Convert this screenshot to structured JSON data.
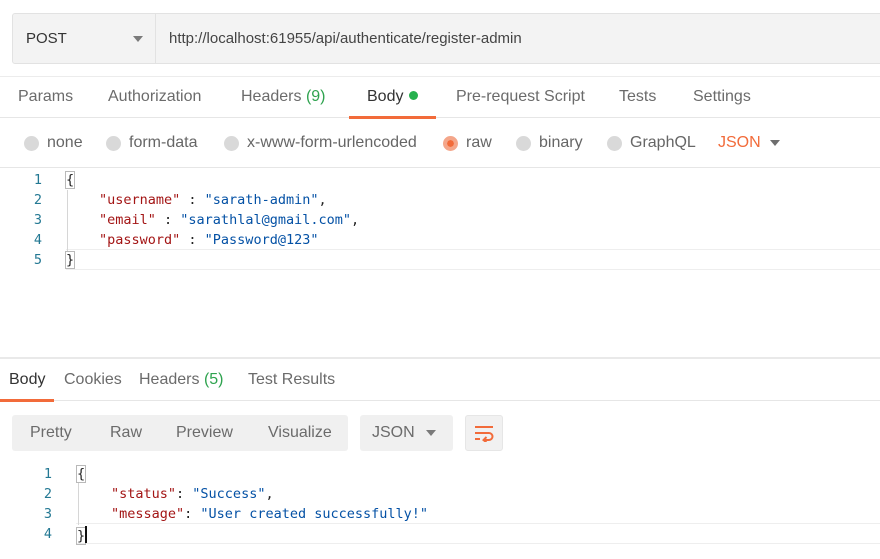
{
  "request": {
    "method": "POST",
    "url": "http://localhost:61955/api/authenticate/register-admin"
  },
  "request_tabs": [
    {
      "label": "Params"
    },
    {
      "label": "Authorization"
    },
    {
      "label": "Headers",
      "count": "(9)"
    },
    {
      "label": "Body",
      "active": true
    },
    {
      "label": "Pre-request Script"
    },
    {
      "label": "Tests"
    },
    {
      "label": "Settings"
    }
  ],
  "body_types": [
    {
      "label": "none"
    },
    {
      "label": "form-data"
    },
    {
      "label": "x-www-form-urlencoded"
    },
    {
      "label": "raw",
      "selected": true
    },
    {
      "label": "binary"
    },
    {
      "label": "GraphQL"
    }
  ],
  "body_language": "JSON",
  "request_body": {
    "line_numbers": [
      "1",
      "2",
      "3",
      "4",
      "5"
    ],
    "open_brace": "{",
    "close_brace": "}",
    "fields": [
      {
        "key": "\"username\"",
        "sep": " : ",
        "value": "\"sarath-admin\"",
        "trail": ","
      },
      {
        "key": "\"email\"",
        "sep": " : ",
        "value": "\"sarathlal@gmail.com\"",
        "trail": ","
      },
      {
        "key": "\"password\"",
        "sep": " : ",
        "value": "\"Password@123\"",
        "trail": ""
      }
    ]
  },
  "response_tabs": [
    {
      "label": "Body",
      "active": true
    },
    {
      "label": "Cookies"
    },
    {
      "label": "Headers",
      "count": "(5)"
    },
    {
      "label": "Test Results"
    }
  ],
  "response_views": [
    "Pretty",
    "Raw",
    "Preview",
    "Visualize"
  ],
  "response_format": "JSON",
  "response_body": {
    "line_numbers": [
      "1",
      "2",
      "3",
      "4"
    ],
    "open_brace": "{",
    "close_brace": "}",
    "fields": [
      {
        "key": "\"status\"",
        "sep": ": ",
        "value": "\"Success\"",
        "trail": ","
      },
      {
        "key": "\"message\"",
        "sep": ": ",
        "value": "\"User created successfully!\"",
        "trail": ""
      }
    ]
  },
  "colors": {
    "accent": "#f26b3a",
    "count_green": "#2fa34f",
    "dot_green": "#27b14e",
    "json_key": "#a31515",
    "json_string": "#0451a5",
    "line_number": "#237893"
  },
  "icons": {
    "method_dropdown": "chevron-down-icon",
    "wrap_lines": "wrap-icon"
  }
}
